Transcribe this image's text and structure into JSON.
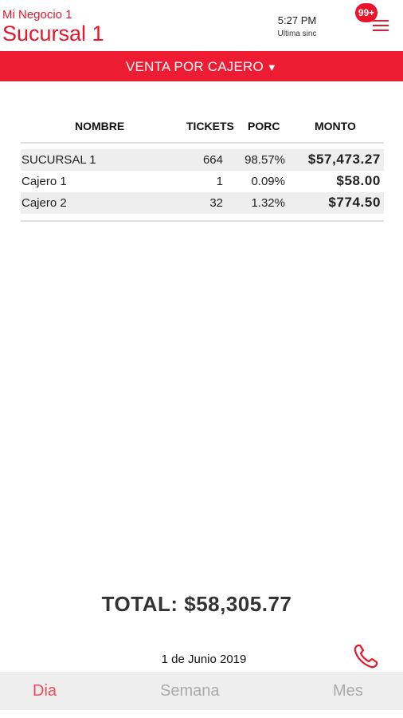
{
  "header": {
    "business_name": "Mi Negocio 1",
    "branch_name": "Sucursal 1",
    "sync_time": "5:27 PM",
    "sync_label": "Ultima sinc",
    "notification_count": "99+",
    "menu_icon": "hamburger-menu-icon"
  },
  "report_selector": {
    "label": "VENTA POR CAJERO",
    "arrow": "▼"
  },
  "table": {
    "columns": [
      "NOMBRE",
      "TICKETS",
      "PORC",
      "MONTO"
    ],
    "rows": [
      {
        "name": "SUCURSAL 1",
        "tickets": "664",
        "porc": "98.57%",
        "monto": "$57,473.27"
      },
      {
        "name": "Cajero 1",
        "tickets": "1",
        "porc": "0.09%",
        "monto": "$58.00"
      },
      {
        "name": "Cajero 2",
        "tickets": "32",
        "porc": "1.32%",
        "monto": "$774.50"
      }
    ]
  },
  "total": "TOTAL: $58,305.77",
  "date": "1 de Junio 2019",
  "call_icon": "phone-icon",
  "tabs": [
    {
      "label": "Dia",
      "active": true
    },
    {
      "label": "Semana",
      "active": false
    },
    {
      "label": "Mes",
      "active": false
    }
  ],
  "colors": {
    "accent": "#ee1c33",
    "active_tab": "#ef4a5e",
    "inactive_tab": "#aaaaaa",
    "tabbar_bg": "#eeeeee"
  }
}
